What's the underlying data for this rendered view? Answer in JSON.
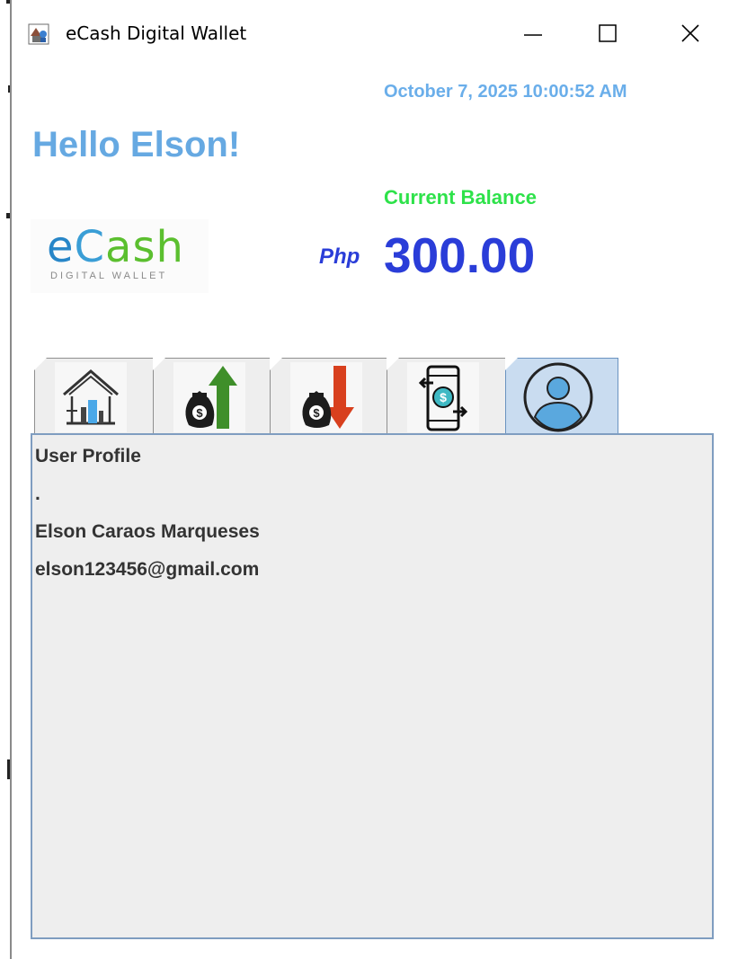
{
  "window": {
    "title": "eCash Digital Wallet",
    "icon": "app-icon",
    "minimize_glyph": "—",
    "maximize_glyph": "☐",
    "close_glyph": "✕"
  },
  "header": {
    "datetime": "October 7, 2025 10:00:52 AM",
    "greeting": "Hello Elson!",
    "balance_label": "Current Balance",
    "currency": "Php",
    "balance": "300.00"
  },
  "logo": {
    "text_e": "e",
    "text_c": "C",
    "text_ash": "ash",
    "subtitle": "DIGITAL WALLET"
  },
  "tabs": [
    {
      "icon": "home-icon",
      "selected": false
    },
    {
      "icon": "cash-in-icon",
      "selected": false
    },
    {
      "icon": "cash-out-icon",
      "selected": false
    },
    {
      "icon": "transfer-icon",
      "selected": false
    },
    {
      "icon": "user-profile-icon",
      "selected": true
    }
  ],
  "profile": {
    "heading": "User Profile",
    "dot": ".",
    "name": "Elson Caraos Marqueses",
    "email": "elson123456@gmail.com"
  },
  "colors": {
    "greeting": "#66a9e2",
    "datetime": "#6aaeea",
    "balance_label": "#2ee24a",
    "balance": "#2a3dd8",
    "panel_border": "#7f9dc0"
  }
}
